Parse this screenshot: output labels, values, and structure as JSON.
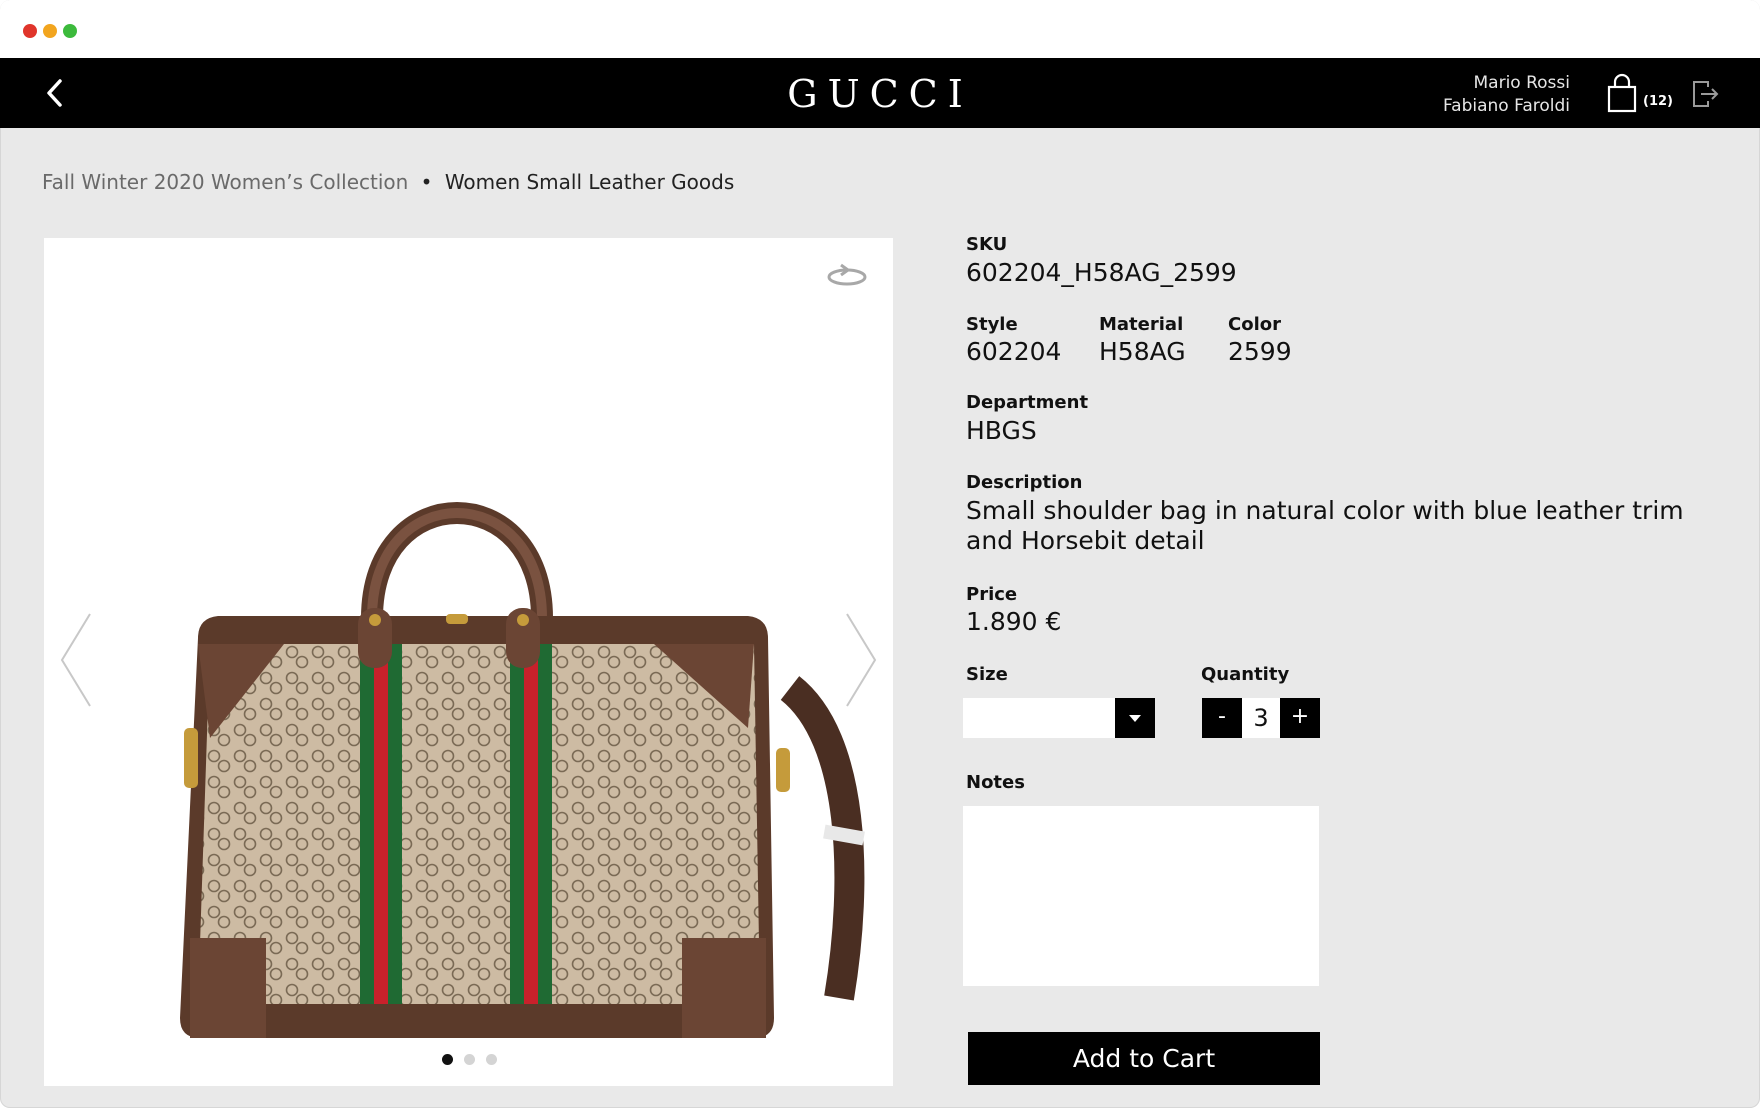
{
  "navbar": {
    "logo": "GUCCI",
    "user_name": "Mario Rossi",
    "store_name": "Fabiano Faroldi",
    "cart_count": "(12)",
    "icons": [
      "back-arrow-icon",
      "shopping-bag-icon",
      "logout-icon"
    ]
  },
  "breadcrumb": {
    "collection": "Fall Winter 2020 Women’s Collection",
    "separator": "•",
    "category": "Women Small Leather Goods"
  },
  "gallery": {
    "pages": 3,
    "active_page": 1,
    "icons": [
      "rotate-360-icon",
      "chevron-left-icon",
      "chevron-right-icon"
    ]
  },
  "product": {
    "sku_label": "SKU",
    "sku": "602204_H58AG_2599",
    "style_label": "Style",
    "style": "602204",
    "material_label": "Material",
    "material": "H58AG",
    "color_label": "Color",
    "color": "2599",
    "department_label": "Department",
    "department": "HBGS",
    "description_label": "Description",
    "description": "Small shoulder bag in natural color with blue leather trim and Horsebit detail",
    "price_label": "Price",
    "price": "1.890 €"
  },
  "order": {
    "size_label": "Size",
    "size_value": "",
    "quantity_label": "Quantity",
    "quantity": "3",
    "minus": "-",
    "plus": "+",
    "notes_label": "Notes",
    "notes_value": "",
    "add_to_cart": "Add to Cart"
  },
  "colors": {
    "nav_bg": "#000000",
    "page_bg": "#e9e9e9",
    "canvas_bg": "#ffffff",
    "gucci_green": "#1f6a33",
    "gucci_red": "#c8212b"
  }
}
